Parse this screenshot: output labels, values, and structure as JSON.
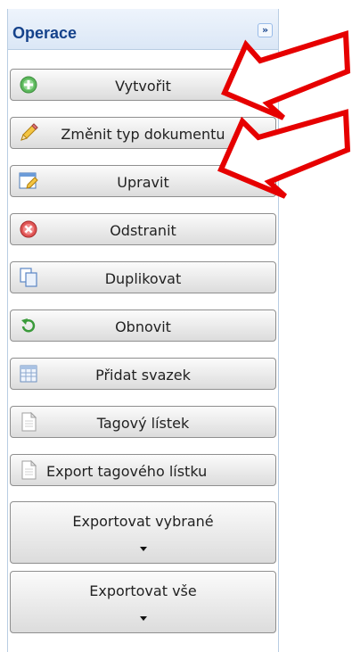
{
  "panel": {
    "title": "Operace",
    "collapse_glyph": "»"
  },
  "buttons": {
    "create": {
      "label": "Vytvořit",
      "icon": "add-icon"
    },
    "change_type": {
      "label": "Změnit typ dokumentu",
      "icon": "pencil-icon"
    },
    "edit": {
      "label": "Upravit",
      "icon": "edit-window-icon"
    },
    "delete": {
      "label": "Odstranit",
      "icon": "delete-icon"
    },
    "duplicate": {
      "label": "Duplikovat",
      "icon": "copy-icon"
    },
    "refresh": {
      "label": "Obnovit",
      "icon": "refresh-icon"
    },
    "add_bundle": {
      "label": "Přidat svazek",
      "icon": "table-icon"
    },
    "tag_sheet": {
      "label": "Tagový lístek",
      "icon": "document-icon"
    },
    "export_tag_sheet": {
      "label": "Export tagového lístku",
      "icon": "document-icon"
    },
    "export_selected": {
      "label": "Exportovat vybrané"
    },
    "export_all": {
      "label": "Exportovat vše"
    }
  },
  "colors": {
    "arrow": "#e00000",
    "panel_title": "#15428b"
  }
}
